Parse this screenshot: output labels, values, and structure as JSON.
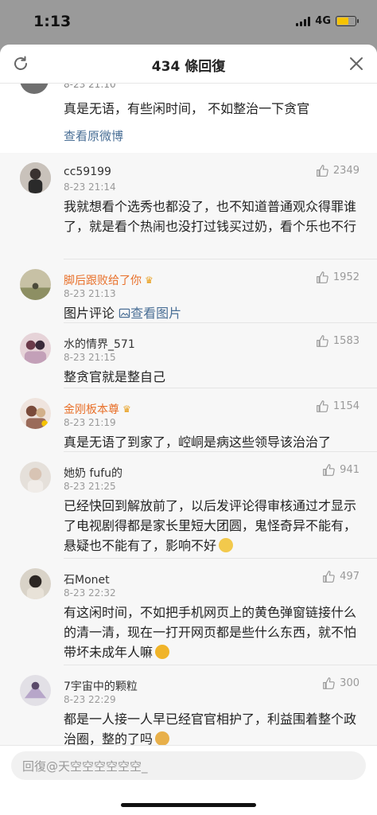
{
  "status": {
    "time": "1:13",
    "network": "4G",
    "battery_level": 0.7,
    "battery_color": "#f5c300"
  },
  "header": {
    "title": "434 條回復",
    "refresh_icon": "refresh-icon",
    "close_icon": "close-icon"
  },
  "parent": {
    "time": "8-23 21:10",
    "text": "真是无语，有些闲时间， 不如整治一下贪官",
    "view_original": "查看原微博"
  },
  "comments": [
    {
      "user": "cc59199",
      "time": "8-23 21:14",
      "likes": "2349",
      "gold": false,
      "crown": false,
      "text": "我就想看个选秀也都没了，也不知道普通观众得罪谁了，就是看个热闹也没打过钱买过奶，看个乐也不行"
    },
    {
      "user": "脚后跟败给了你",
      "time": "8-23 21:13",
      "likes": "1952",
      "gold": true,
      "crown": true,
      "text": "图片评论",
      "image_link": "查看图片"
    },
    {
      "user": "水的情界_571",
      "time": "8-23 21:15",
      "likes": "1583",
      "gold": false,
      "crown": false,
      "text": "整贪官就是整自己"
    },
    {
      "user": "金刚板本尊",
      "time": "8-23 21:19",
      "likes": "1154",
      "gold": true,
      "crown": true,
      "text": "真是无语了到家了，崆峒是病这些领导该治治了"
    },
    {
      "user": "她奶 fufu的",
      "time": "8-23 21:25",
      "likes": "941",
      "gold": false,
      "crown": false,
      "text": "已经快回到解放前了，以后发评论得审核通过才显示了电视剧得都是家长里短大团圆，鬼怪奇异不能有，悬疑也不能有了，影响不好"
    },
    {
      "user": "石Monet",
      "time": "8-23 22:32",
      "likes": "497",
      "gold": false,
      "crown": false,
      "text": "有这闲时间，不如把手机网页上的黄色弹窗链接什么的清一清，现在一打开网页都是些什么东西，就不怕带坏未成年人嘛"
    },
    {
      "user": "7宇宙中的颗粒",
      "time": "8-23 22:29",
      "likes": "300",
      "gold": false,
      "crown": false,
      "text": "都是一人接一人早已经官官相护了，利益围着整个政治圈，整的了吗"
    }
  ],
  "reply": {
    "placeholder": "回復@天空空空空空空_"
  },
  "colors": {
    "link": "#4a6f96",
    "gold_name": "#e8702a",
    "muted": "#9a9a9a"
  }
}
